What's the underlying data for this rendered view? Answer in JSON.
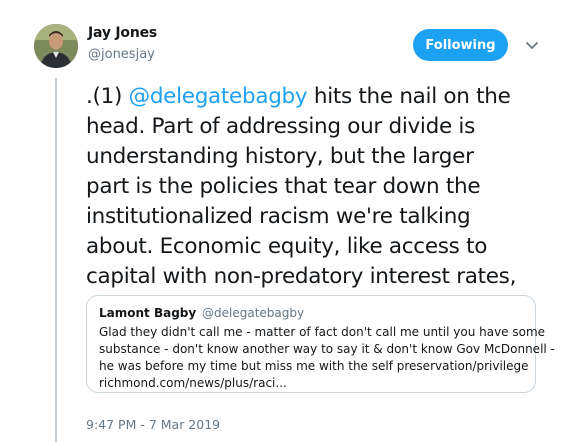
{
  "author": {
    "display_name": "Jay Jones",
    "handle": "@jonesjay"
  },
  "follow_button": {
    "label": "Following",
    "color": "#1da1f2"
  },
  "more_menu": {
    "icon": "chevron-down-icon"
  },
  "tweet": {
    "lines": [
      {
        "prefix": ".(1) ",
        "mention": "@delegatebagby",
        "suffix": " hits the nail on the"
      },
      {
        "text": "head. Part of addressing our divide is"
      },
      {
        "text": "understanding history, but the larger"
      },
      {
        "text": "part is the policies that tear down the"
      },
      {
        "text": "institutionalized racism we're talking"
      },
      {
        "text": "about. Economic equity, like access to"
      },
      {
        "text": "capital with non-predatory interest rates,"
      }
    ],
    "mention_color": "#1da1f2"
  },
  "quote": {
    "name": "Lamont Bagby",
    "handle": "@delegatebagby",
    "lines": [
      "Glad they didn't call me - matter of fact don't call me until you have some",
      "substance - don't know another way to say it & don't know Gov McDonnell -",
      "he was before my time but miss me with the self preservation/privilege",
      "richmond.com/news/plus/raci..."
    ]
  },
  "timestamp": "9:47 PM - 7 Mar 2019"
}
